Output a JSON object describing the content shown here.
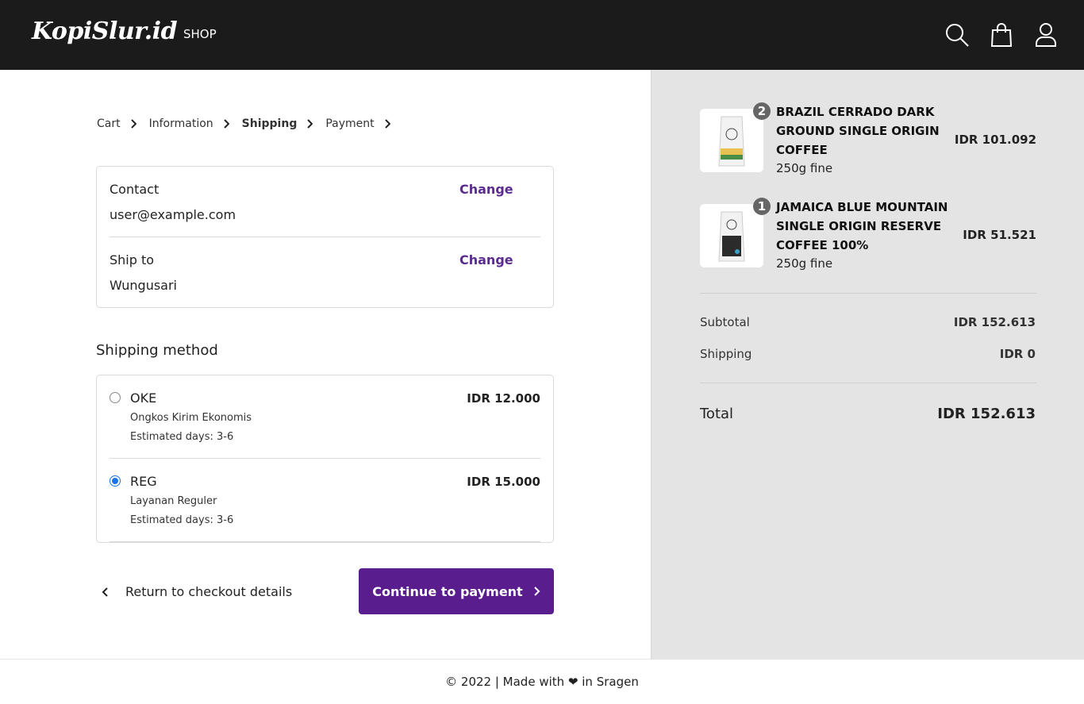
{
  "header": {
    "logo": "KopiSlur.id",
    "nav_shop": "SHOP",
    "icons": [
      "search-icon",
      "shopping-bag-icon",
      "user-icon"
    ]
  },
  "breadcrumb": {
    "items": [
      "Cart",
      "Information",
      "Shipping",
      "Payment"
    ],
    "active": "Shipping"
  },
  "review": {
    "contact_label": "Contact",
    "contact_value": "user@example.com",
    "ship_to_label": "Ship to",
    "ship_to_value": "Wungusari",
    "change_label": "Change"
  },
  "shipping": {
    "title": "Shipping method",
    "options": [
      {
        "name": "OKE",
        "description": "Ongkos Kirim Ekonomis",
        "estimate": "Estimated days: 3-6",
        "price": "IDR 12.000",
        "selected": false
      },
      {
        "name": "REG",
        "description": "Layanan Reguler",
        "estimate": "Estimated days: 3-6",
        "price": "IDR 15.000",
        "selected": true
      }
    ]
  },
  "actions": {
    "return_label": "Return to checkout details",
    "continue_label": "Continue to payment"
  },
  "order": {
    "items": [
      {
        "quantity": "2",
        "name": "BRAZIL CERRADO DARK GROUND SINGLE ORIGIN COFFEE",
        "variant": "250g fine",
        "price": "IDR 101.092"
      },
      {
        "quantity": "1",
        "name": "JAMAICA BLUE MOUNTAIN SINGLE ORIGIN RESERVE COFFEE 100%",
        "variant": "250g fine",
        "price": "IDR 51.521"
      }
    ],
    "subtotal_label": "Subtotal",
    "subtotal_value": "IDR 152.613",
    "shipping_label": "Shipping",
    "shipping_value": "IDR 0",
    "total_label": "Total",
    "total_value": "IDR 152.613"
  },
  "footer": {
    "text": "© 2022 | Made with ❤ in Sragen"
  },
  "colors": {
    "accent": "#5a1d8e",
    "topbar": "#1b1b1b",
    "sidebar_bg": "#e4e4e4"
  }
}
